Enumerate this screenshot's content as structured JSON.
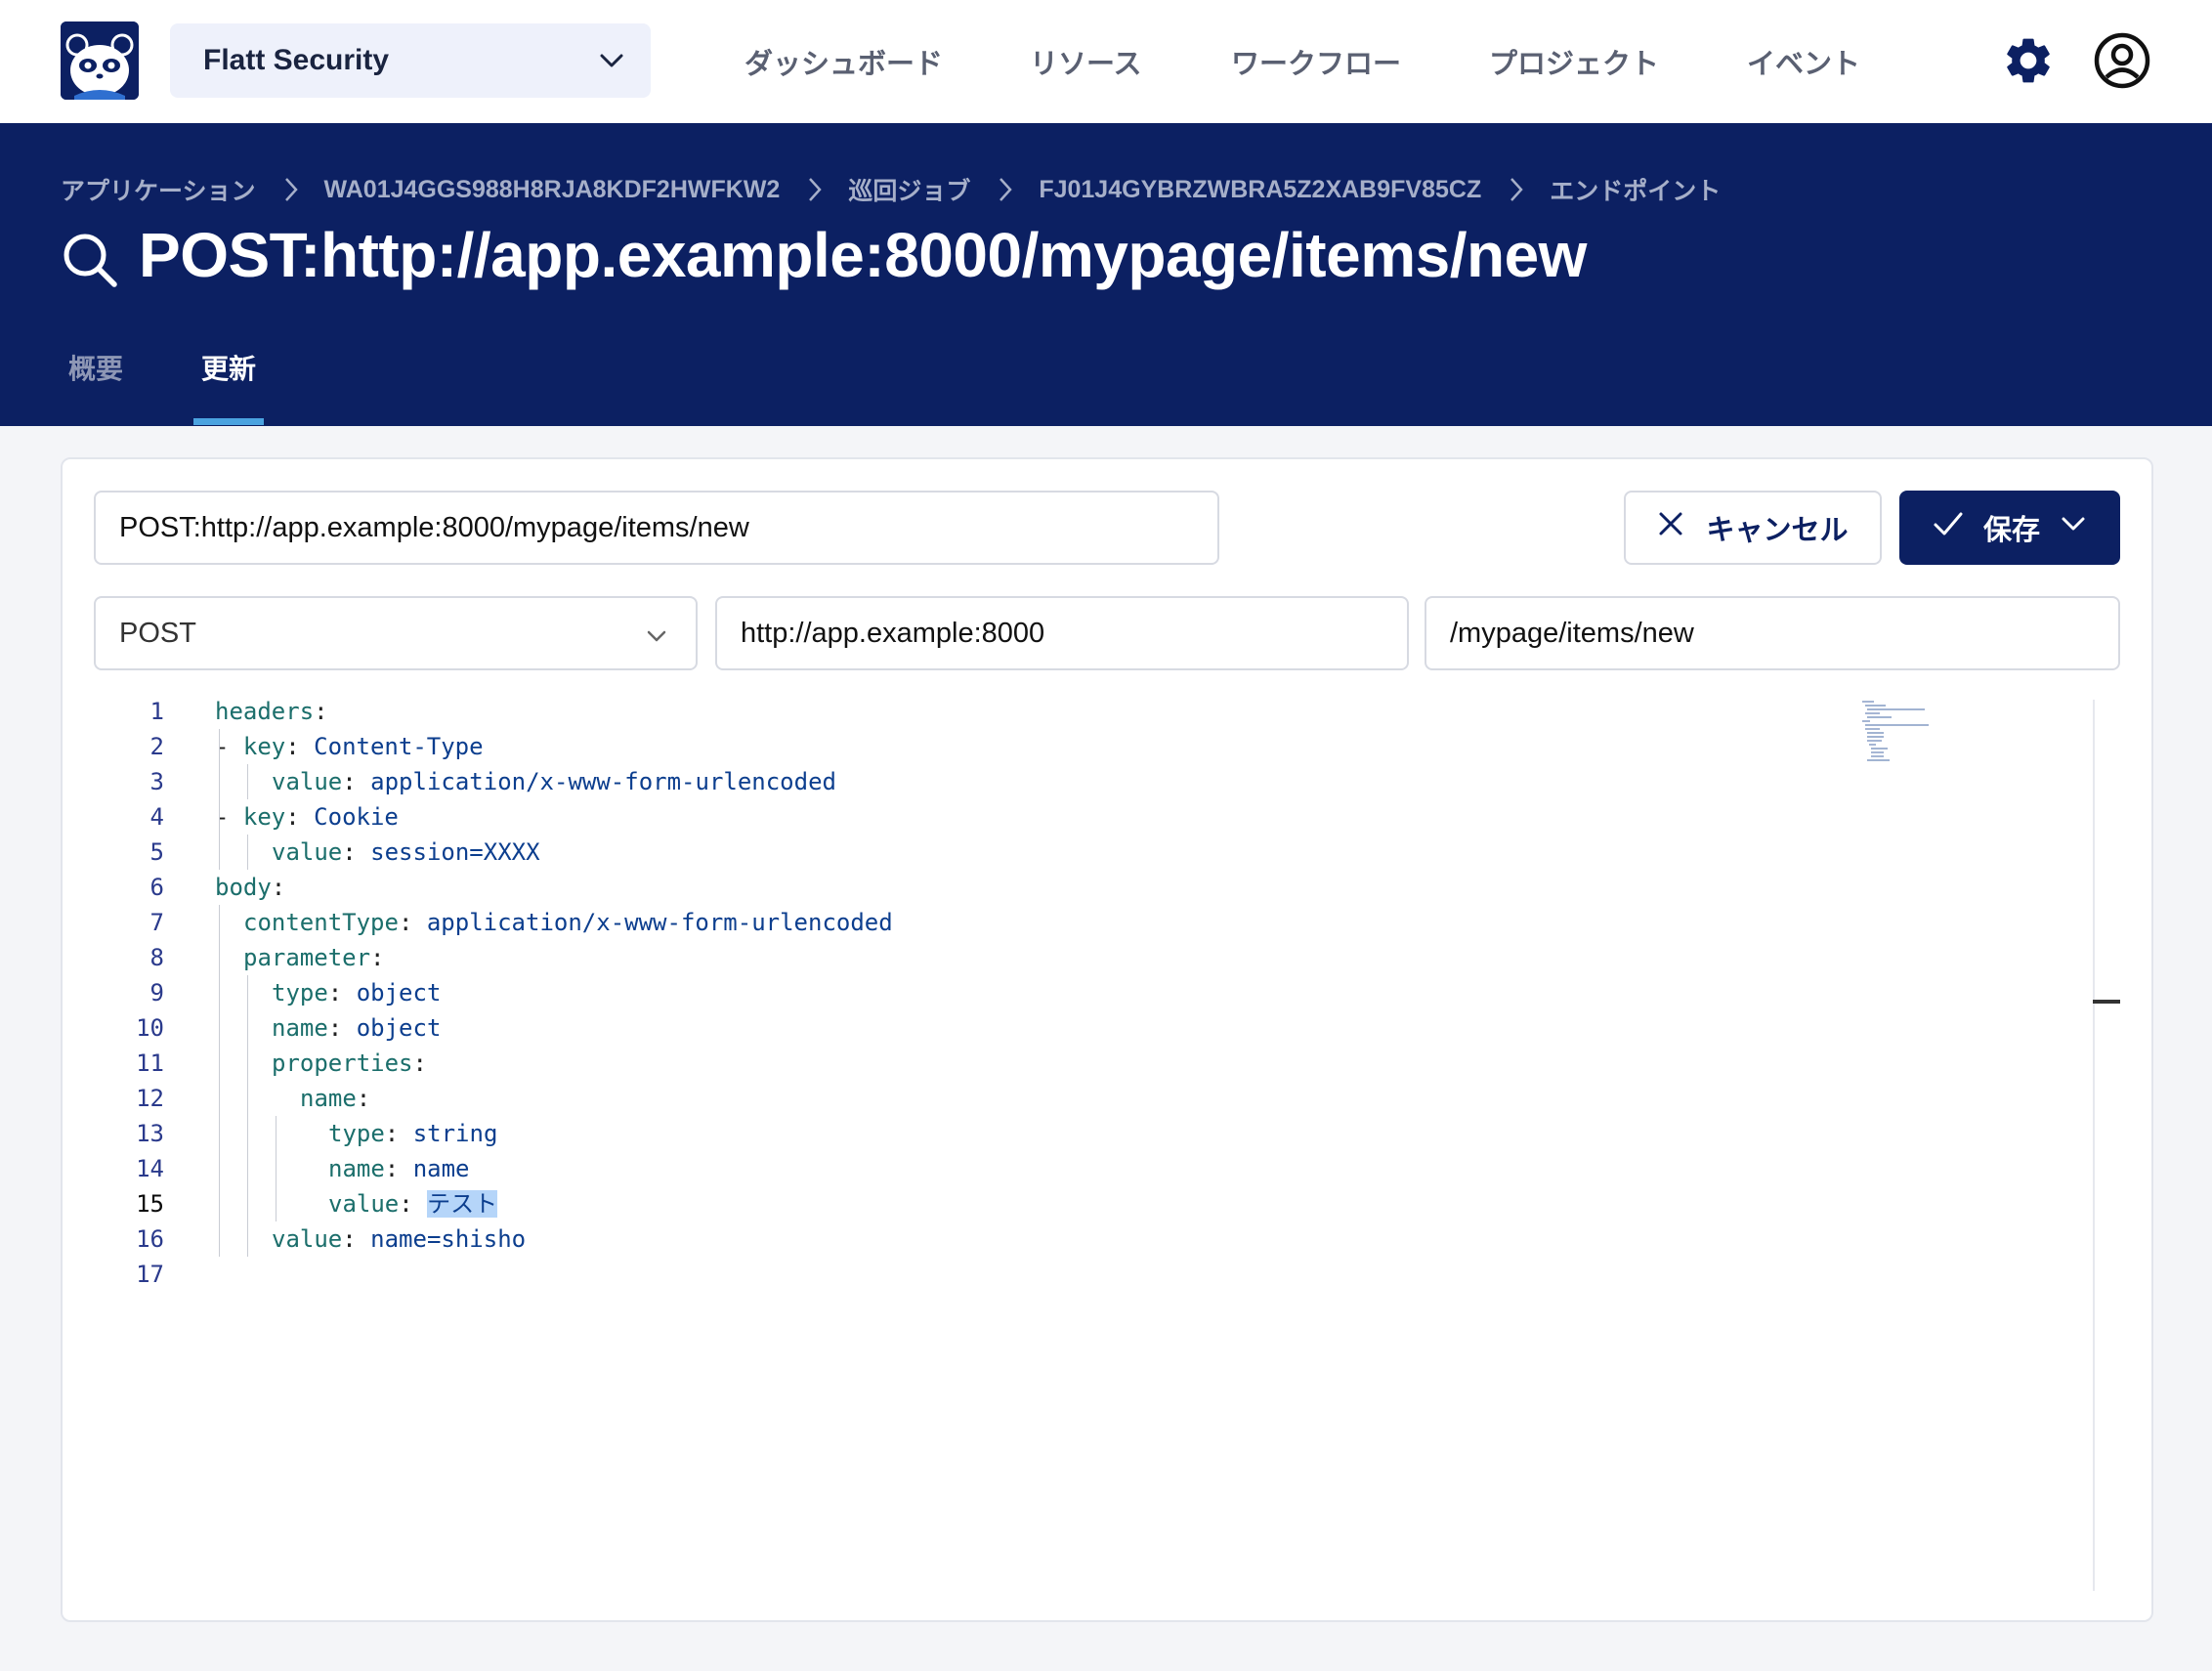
{
  "org_select": {
    "label": "Flatt Security"
  },
  "nav": {
    "items": [
      {
        "label": "ダッシュボード"
      },
      {
        "label": "リソース"
      },
      {
        "label": "ワークフロー"
      },
      {
        "label": "プロジェクト"
      },
      {
        "label": "イベント"
      }
    ]
  },
  "breadcrumb": [
    {
      "label": "アプリケーション"
    },
    {
      "label": "WA01J4GGS988H8RJA8KDF2HWFKW2"
    },
    {
      "label": "巡回ジョブ"
    },
    {
      "label": "FJ01J4GYBRZWBRA5Z2XAB9FV85CZ"
    },
    {
      "label": "エンドポイント"
    }
  ],
  "page_title": "POST:http://app.example:8000/mypage/items/new",
  "tabs": [
    {
      "label": "概要",
      "active": false
    },
    {
      "label": "更新",
      "active": true
    }
  ],
  "form": {
    "name_value": "POST:http://app.example:8000/mypage/items/new",
    "cancel_label": "キャンセル",
    "save_label": "保存",
    "method_value": "POST",
    "origin_value": "http://app.example:8000",
    "path_value": "/mypage/items/new"
  },
  "editor": {
    "current_line": 15,
    "lines": [
      {
        "n": "1",
        "indent": 0,
        "dash": false,
        "key": "headers",
        "value": ""
      },
      {
        "n": "2",
        "indent": 1,
        "dash": true,
        "key": "key",
        "value": "Content-Type"
      },
      {
        "n": "3",
        "indent": 2,
        "dash": false,
        "key": "value",
        "value": "application/x-www-form-urlencoded"
      },
      {
        "n": "4",
        "indent": 1,
        "dash": true,
        "key": "key",
        "value": "Cookie"
      },
      {
        "n": "5",
        "indent": 2,
        "dash": false,
        "key": "value",
        "value": "session=XXXX"
      },
      {
        "n": "6",
        "indent": 0,
        "dash": false,
        "key": "body",
        "value": ""
      },
      {
        "n": "7",
        "indent": 1,
        "dash": false,
        "key": "contentType",
        "value": "application/x-www-form-urlencoded"
      },
      {
        "n": "8",
        "indent": 1,
        "dash": false,
        "key": "parameter",
        "value": ""
      },
      {
        "n": "9",
        "indent": 2,
        "dash": false,
        "key": "type",
        "value": "object"
      },
      {
        "n": "10",
        "indent": 2,
        "dash": false,
        "key": "name",
        "value": "object"
      },
      {
        "n": "11",
        "indent": 2,
        "dash": false,
        "key": "properties",
        "value": ""
      },
      {
        "n": "12",
        "indent": 3,
        "dash": false,
        "key": "name",
        "value": ""
      },
      {
        "n": "13",
        "indent": 4,
        "dash": false,
        "key": "type",
        "value": "string"
      },
      {
        "n": "14",
        "indent": 4,
        "dash": false,
        "key": "name",
        "value": "name"
      },
      {
        "n": "15",
        "indent": 4,
        "dash": false,
        "key": "value",
        "value": "テスト"
      },
      {
        "n": "16",
        "indent": 2,
        "dash": false,
        "key": "value",
        "value": "name=shisho"
      },
      {
        "n": "17",
        "indent": 0,
        "dash": false,
        "key": "",
        "value": ""
      }
    ]
  },
  "icons": {
    "logo": "panda-logo-icon",
    "org_chevron": "chevron-down-icon",
    "settings": "gear-icon",
    "account": "user-circle-icon",
    "title": "search-icon",
    "cancel": "close-icon",
    "save": "check-icon"
  },
  "colors": {
    "brand_navy": "#0c2062",
    "tab_underline": "#4ba3e0",
    "selection": "#b5d5f9"
  }
}
